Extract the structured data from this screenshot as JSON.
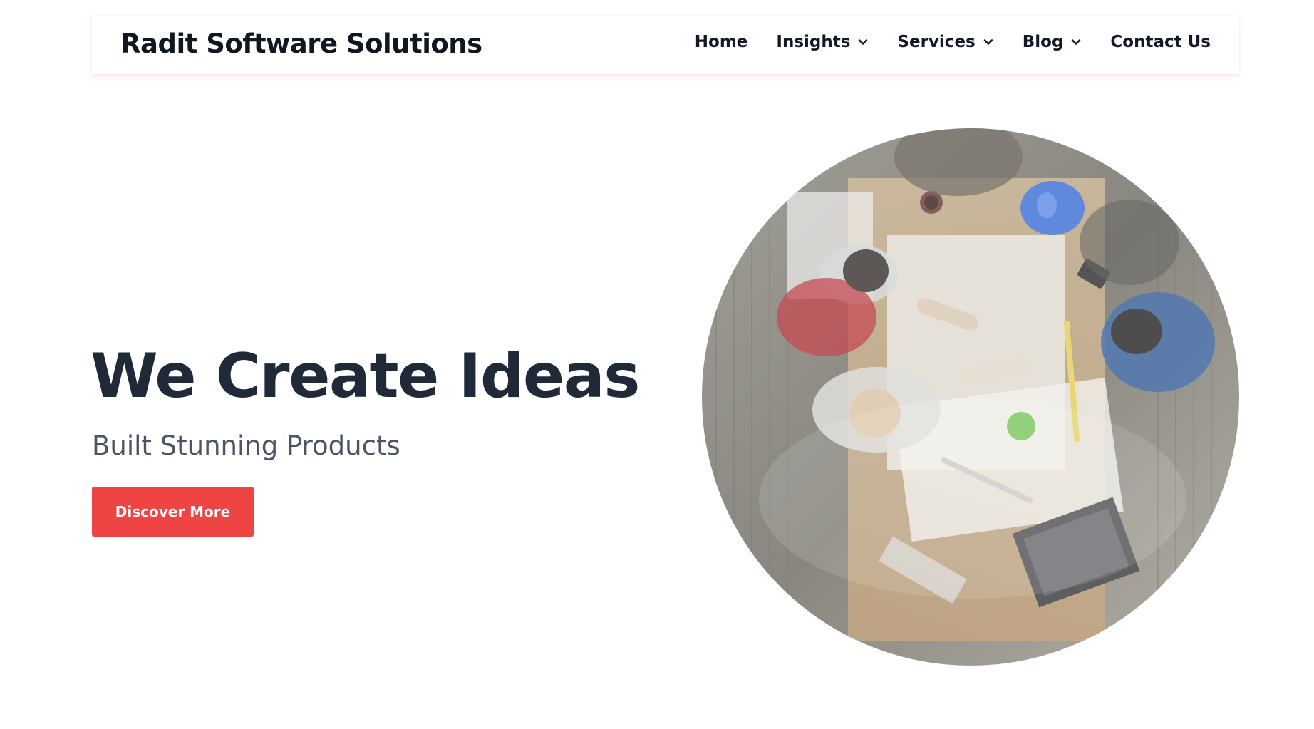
{
  "header": {
    "brand": "Radit Software Solutions",
    "nav": [
      {
        "label": "Home",
        "has_dropdown": false
      },
      {
        "label": "Insights",
        "has_dropdown": true
      },
      {
        "label": "Services",
        "has_dropdown": true
      },
      {
        "label": "Blog",
        "has_dropdown": true
      },
      {
        "label": "Contact Us",
        "has_dropdown": false
      }
    ]
  },
  "hero": {
    "title": "We Create Ideas",
    "subtitle": "Built Stunning Products",
    "cta_label": "Discover More",
    "image_icon": "team-meeting-photo"
  },
  "colors": {
    "accent": "#ef4444",
    "title": "#1f2937",
    "subtitle": "#4b5563"
  }
}
